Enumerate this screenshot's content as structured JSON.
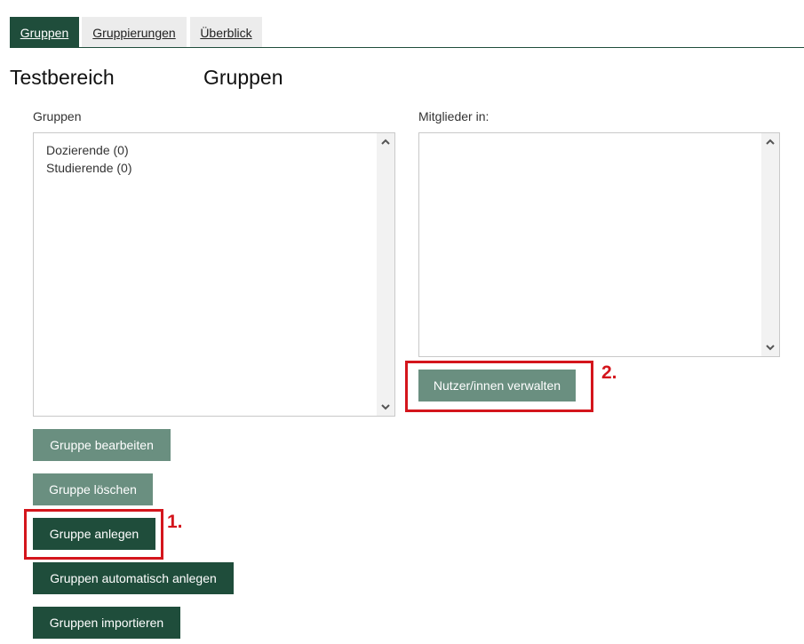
{
  "tabs": [
    {
      "label": "Gruppen",
      "active": true
    },
    {
      "label": "Gruppierungen",
      "active": false
    },
    {
      "label": "Überblick",
      "active": false
    }
  ],
  "headings": {
    "area": "Testbereich",
    "section": "Gruppen"
  },
  "groups_panel": {
    "label": "Gruppen",
    "items": [
      "Dozierende (0)",
      "Studierende (0)"
    ]
  },
  "members_panel": {
    "label": "Mitglieder in:",
    "items": []
  },
  "buttons": {
    "manage_users": "Nutzer/innen verwalten",
    "edit_group": "Gruppe bearbeiten",
    "delete_group": "Gruppe löschen",
    "create_group": "Gruppe anlegen",
    "auto_create_groups": "Gruppen automatisch anlegen",
    "import_groups": "Gruppen importieren"
  },
  "annotations": {
    "step1": "1.",
    "step2": "2."
  },
  "colors": {
    "primary": "#1f4d3b",
    "primary_muted": "#6a8f80",
    "annotation_red": "#d4151c"
  },
  "icons": {
    "scroll_up": "chevron-up-icon",
    "scroll_down": "chevron-down-icon"
  }
}
